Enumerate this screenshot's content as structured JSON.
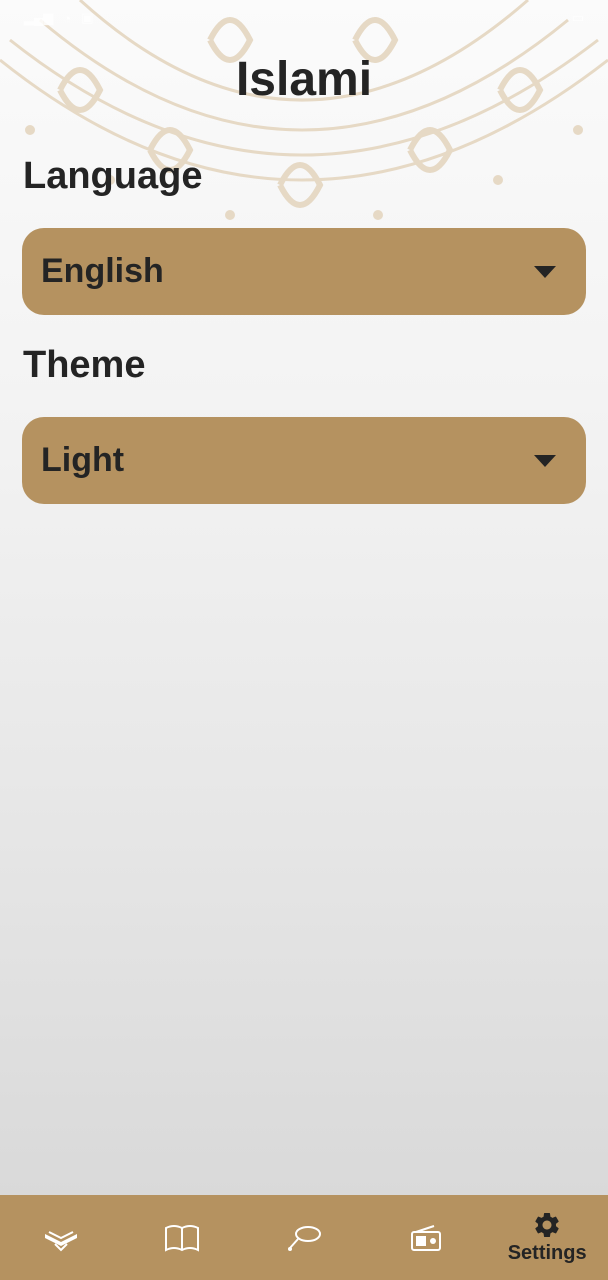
{
  "app": {
    "title": "Islami"
  },
  "settings": {
    "language": {
      "label": "Language",
      "selected": "English"
    },
    "theme": {
      "label": "Theme",
      "selected": "Light"
    }
  },
  "bottom_nav": {
    "items": [
      {
        "icon": "quran-icon",
        "label": ""
      },
      {
        "icon": "hadith-book-icon",
        "label": ""
      },
      {
        "icon": "sebha-icon",
        "label": ""
      },
      {
        "icon": "radio-icon",
        "label": ""
      },
      {
        "icon": "gear-icon",
        "label": "Settings",
        "active": true
      }
    ]
  },
  "colors": {
    "accent": "#b59260",
    "text": "#242424",
    "inactive_icon": "#ffffff"
  }
}
